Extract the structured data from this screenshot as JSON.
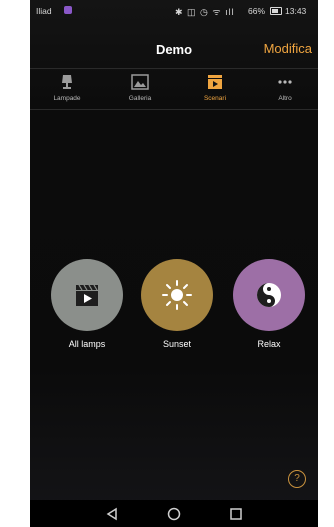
{
  "status_bar": {
    "carrier": "Iliad",
    "battery": "66%",
    "time": "13:43"
  },
  "header": {
    "title": "Demo",
    "edit_label": "Modifica"
  },
  "tabs": [
    {
      "label": "Lampade",
      "icon": "lamp-icon"
    },
    {
      "label": "Galleria",
      "icon": "gallery-icon"
    },
    {
      "label": "Scenari",
      "icon": "scene-icon",
      "active": true
    },
    {
      "label": "Altro",
      "icon": "more-icon"
    }
  ],
  "scenes": [
    {
      "label": "All lamps",
      "icon": "clapperboard-icon",
      "color": "#8b8f8b"
    },
    {
      "label": "Sunset",
      "icon": "sun-icon",
      "color": "#a58440"
    },
    {
      "label": "Relax",
      "icon": "yin-yang-icon",
      "color": "#9d6fa6"
    }
  ],
  "help": {
    "label": "?"
  },
  "colors": {
    "accent": "#f0a540",
    "background": "#0c0c0c"
  }
}
